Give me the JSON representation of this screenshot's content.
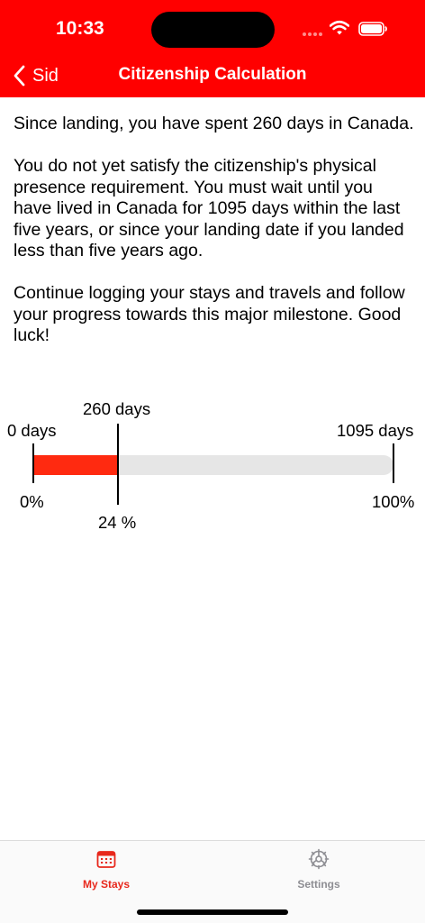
{
  "status_bar": {
    "time": "10:33"
  },
  "nav": {
    "back_label": "Sid",
    "title": "Citizenship Calculation"
  },
  "content": {
    "paragraphs": [
      "Since landing, you have spent 260 days in Canada.",
      "You do not yet satisfy the citizenship's physical presence requirement. You must wait until you have lived in Canada for 1095 days within the last five years, or since your landing date if you landed less than five years ago.",
      "Continue logging your stays and travels and follow your progress towards this major milestone. Good luck!"
    ]
  },
  "progress": {
    "current_days_label": "260 days",
    "start_days_label": "0 days",
    "end_days_label": "1095 days",
    "start_percent_label": "0%",
    "end_percent_label": "100%",
    "current_percent_label": "24 %",
    "current_days": 260,
    "required_days": 1095,
    "fill_color": "#ff2a10",
    "track_color": "#e6e6e6"
  },
  "tabbar": {
    "tabs": [
      {
        "label": "My Stays",
        "icon": "calendar-icon",
        "active": true
      },
      {
        "label": "Settings",
        "icon": "gear-icon",
        "active": false
      }
    ],
    "active_color": "#e8281c",
    "inactive_color": "#8e8e93"
  },
  "colors": {
    "header": "#ff0000"
  }
}
